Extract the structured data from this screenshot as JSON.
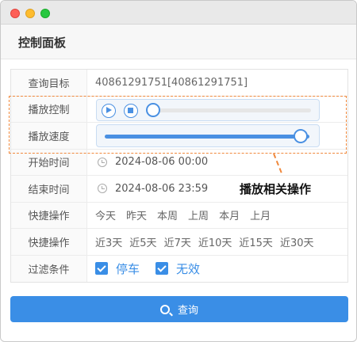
{
  "header": {
    "title": "控制面板"
  },
  "form": {
    "target": {
      "label": "查询目标",
      "value": "40861291751[40861291751]"
    },
    "playback": {
      "label": "播放控制",
      "progress": 0.0
    },
    "speed": {
      "label": "播放速度",
      "level": 1.0
    },
    "start_time": {
      "label": "开始时间",
      "value": "2024-08-06 00:00"
    },
    "end_time": {
      "label": "结束时间",
      "value": "2024-08-06 23:59"
    },
    "quick1": {
      "label": "快捷操作",
      "items": [
        "今天",
        "昨天",
        "本周",
        "上周",
        "本月",
        "上月"
      ]
    },
    "quick2": {
      "label": "快捷操作",
      "items": [
        "近3天",
        "近5天",
        "近7天",
        "近10天",
        "近15天",
        "近30天"
      ]
    },
    "filter": {
      "label": "过滤条件",
      "options": [
        {
          "label": "停车",
          "checked": true
        },
        {
          "label": "无效",
          "checked": true
        }
      ]
    }
  },
  "annotation": {
    "text": "播放相关操作"
  },
  "query_button": {
    "label": "查询"
  },
  "icons": [
    "play-icon",
    "stop-icon",
    "clock-icon",
    "search-icon",
    "checkbox-icon"
  ],
  "colors": {
    "accent": "#3a8ee6",
    "annotation": "#f0883c"
  }
}
